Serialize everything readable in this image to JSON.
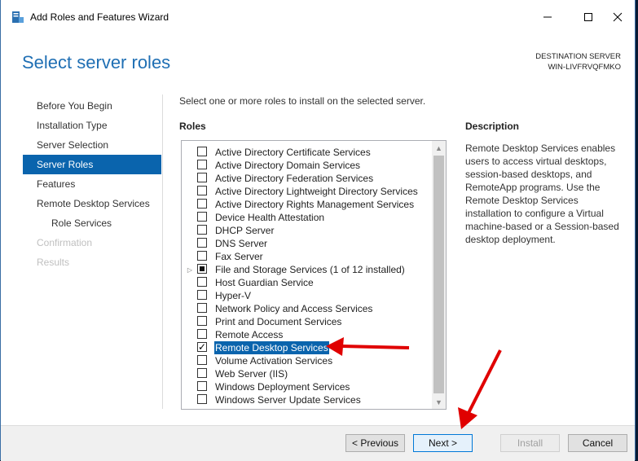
{
  "window": {
    "title": "Add Roles and Features Wizard",
    "page_title": "Select server roles",
    "destination_label": "DESTINATION SERVER",
    "destination_server": "WIN-LIVFRVQFMKO",
    "controls": {
      "minimize": "—",
      "maximize": "☐",
      "close": "✕"
    }
  },
  "nav": {
    "items": [
      {
        "label": "Before You Begin",
        "state": "normal"
      },
      {
        "label": "Installation Type",
        "state": "normal"
      },
      {
        "label": "Server Selection",
        "state": "normal"
      },
      {
        "label": "Server Roles",
        "state": "active"
      },
      {
        "label": "Features",
        "state": "normal"
      },
      {
        "label": "Remote Desktop Services",
        "state": "normal"
      },
      {
        "label": "Role Services",
        "state": "sub"
      },
      {
        "label": "Confirmation",
        "state": "disabled"
      },
      {
        "label": "Results",
        "state": "disabled"
      }
    ]
  },
  "main": {
    "instruction": "Select one or more roles to install on the selected server.",
    "roles_heading": "Roles",
    "roles": [
      {
        "label": "Active Directory Certificate Services",
        "checked": false
      },
      {
        "label": "Active Directory Domain Services",
        "checked": false
      },
      {
        "label": "Active Directory Federation Services",
        "checked": false
      },
      {
        "label": "Active Directory Lightweight Directory Services",
        "checked": false
      },
      {
        "label": "Active Directory Rights Management Services",
        "checked": false
      },
      {
        "label": "Device Health Attestation",
        "checked": false
      },
      {
        "label": "DHCP Server",
        "checked": false
      },
      {
        "label": "DNS Server",
        "checked": false
      },
      {
        "label": "Fax Server",
        "checked": false
      },
      {
        "label": "File and Storage Services (1 of 12 installed)",
        "checked": "partial",
        "expandable": true
      },
      {
        "label": "Host Guardian Service",
        "checked": false
      },
      {
        "label": "Hyper-V",
        "checked": false
      },
      {
        "label": "Network Policy and Access Services",
        "checked": false
      },
      {
        "label": "Print and Document Services",
        "checked": false
      },
      {
        "label": "Remote Access",
        "checked": false
      },
      {
        "label": "Remote Desktop Services",
        "checked": true,
        "selected": true
      },
      {
        "label": "Volume Activation Services",
        "checked": false
      },
      {
        "label": "Web Server (IIS)",
        "checked": false
      },
      {
        "label": "Windows Deployment Services",
        "checked": false
      },
      {
        "label": "Windows Server Update Services",
        "checked": false
      }
    ],
    "description_heading": "Description",
    "description": "Remote Desktop Services enables users to access virtual desktops, session-based desktops, and RemoteApp programs. Use the Remote Desktop Services installation to configure a Virtual machine-based or a Session-based desktop deployment."
  },
  "footer": {
    "previous": "< Previous",
    "next": "Next >",
    "install": "Install",
    "cancel": "Cancel"
  },
  "annotation": {
    "arrow_color": "#e00000"
  }
}
